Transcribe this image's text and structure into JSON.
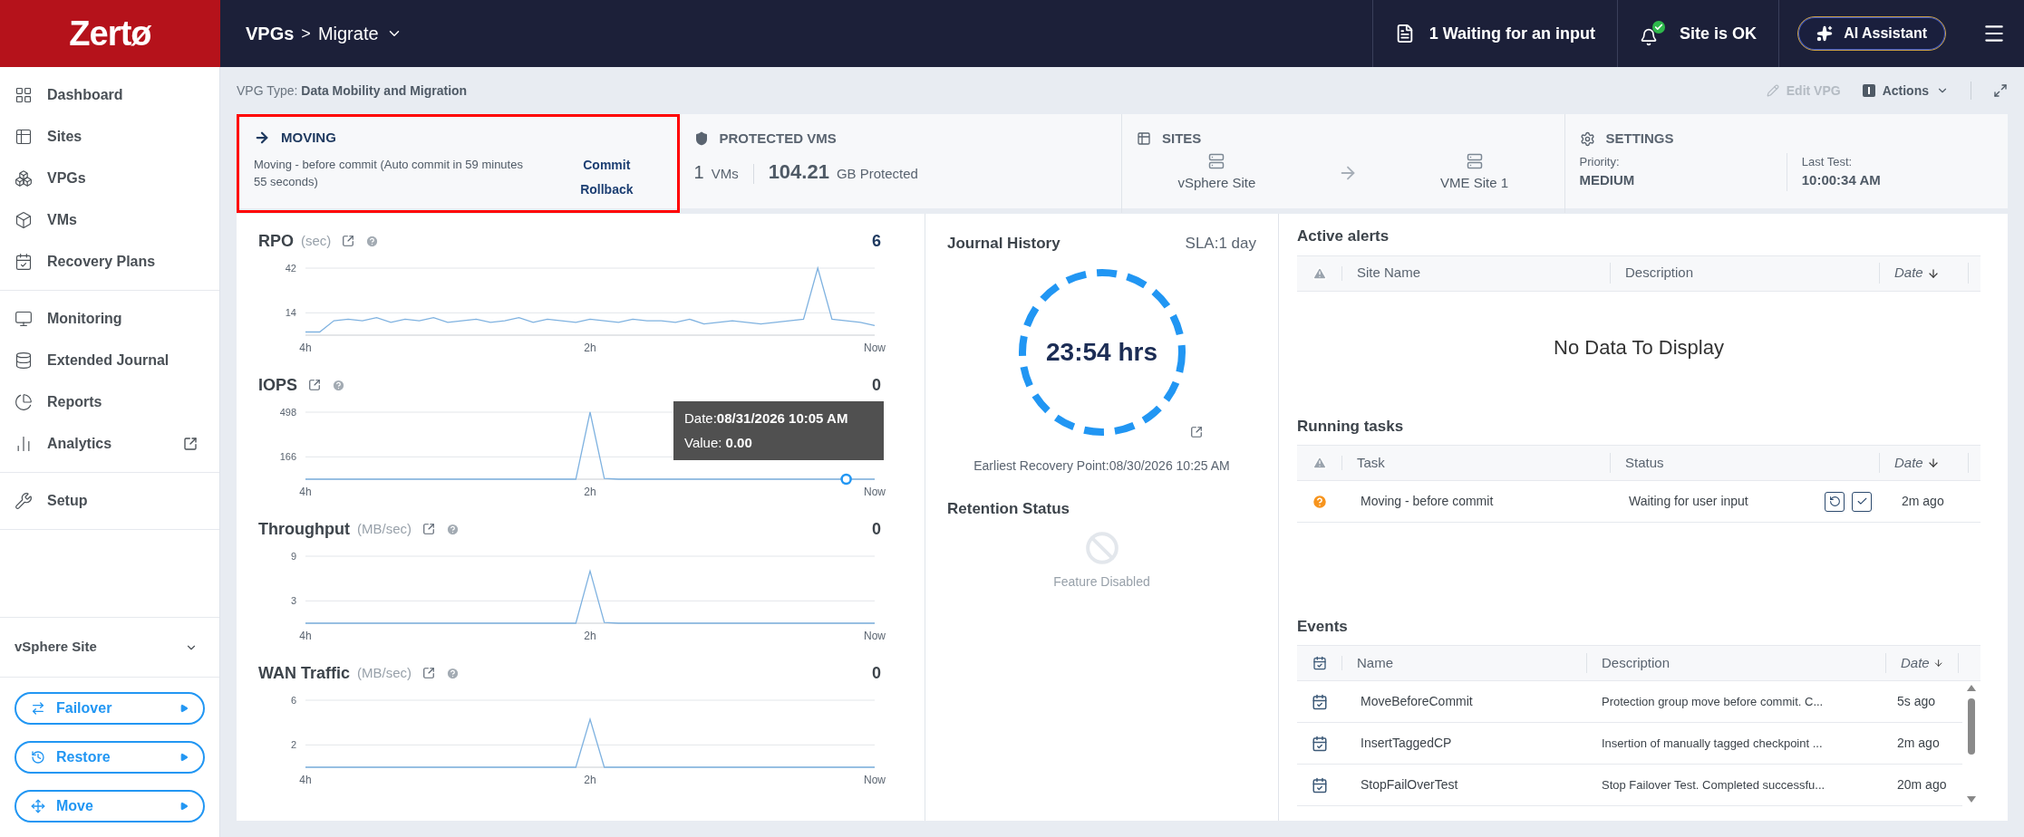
{
  "logo": "Zertø",
  "breadcrumb": {
    "parent": "VPGs",
    "separator": ">",
    "current": "Migrate"
  },
  "header_status": [
    {
      "kind": "tasks",
      "label": "1 Waiting for an input"
    },
    {
      "kind": "site",
      "label": "Site is OK"
    }
  ],
  "ai_button": "AI Assistant",
  "sidebar": {
    "groups": [
      [
        {
          "label": "Dashboard",
          "external": false
        },
        {
          "label": "Sites",
          "external": false
        },
        {
          "label": "VPGs",
          "external": false
        },
        {
          "label": "VMs",
          "external": false
        },
        {
          "label": "Recovery Plans",
          "external": false
        }
      ],
      [
        {
          "label": "Monitoring",
          "external": false
        },
        {
          "label": "Extended Journal",
          "external": false
        },
        {
          "label": "Reports",
          "external": false
        },
        {
          "label": "Analytics",
          "external": true
        }
      ],
      [
        {
          "label": "Setup",
          "external": false
        }
      ]
    ],
    "site_selector": "vSphere Site",
    "actions": [
      "Failover",
      "Restore",
      "Move"
    ]
  },
  "vpg_type": {
    "label": "VPG Type:",
    "value": "Data Mobility and Migration"
  },
  "toolbar": [
    {
      "label": "Edit VPG",
      "disabled": true
    },
    {
      "label": "Actions",
      "disabled": false
    }
  ],
  "status_card": {
    "title": "MOVING",
    "highlighted": true,
    "description": "Moving - before commit (Auto commit in 59 minutes 55 seconds)",
    "links": [
      "Commit",
      "Rollback"
    ]
  },
  "protected_card": {
    "title": "PROTECTED VMS",
    "count": "1",
    "count_unit": "VMs",
    "size": "104.21",
    "size_unit": "GB Protected"
  },
  "sites_card": {
    "title": "SITES",
    "source": "vSphere Site",
    "target": "VME Site 1"
  },
  "settings_card": {
    "title": "SETTINGS",
    "fields": [
      {
        "label": "Priority:",
        "value": "MEDIUM"
      },
      {
        "label": "Last Test:",
        "value": "10:00:34 AM"
      }
    ]
  },
  "charts": [
    {
      "title": "RPO",
      "unit": "(sec)",
      "value": "6",
      "value_highlight": true,
      "chart_data": {
        "type": "line",
        "x": [
          4,
          3.9,
          3.8,
          3.7,
          3.6,
          3.5,
          3.4,
          3.3,
          3.2,
          3.1,
          3,
          2.9,
          2.8,
          2.7,
          2.6,
          2.5,
          2.4,
          2.3,
          2.2,
          2.1,
          2,
          1.9,
          1.8,
          1.7,
          1.6,
          1.5,
          1.4,
          1.3,
          1.2,
          1.1,
          1,
          0.9,
          0.8,
          0.7,
          0.6,
          0.5,
          0.4,
          0.3,
          0.2,
          0.1,
          0
        ],
        "xlim": [
          4,
          0
        ],
        "ylim": [
          0,
          42
        ],
        "yticks": [
          14,
          42
        ],
        "xticks": [
          {
            "value": 4,
            "label": "4h"
          },
          {
            "value": 2,
            "label": "2h"
          },
          {
            "value": 0,
            "label": "Now"
          }
        ],
        "series": [
          {
            "color": "#7fb2e0",
            "values": [
              2,
              2,
              9,
              10,
              9,
              11,
              8,
              10,
              9,
              11,
              8,
              9,
              10,
              8,
              9,
              11,
              8,
              10,
              9,
              8,
              10,
              9,
              8,
              10,
              9,
              9,
              8,
              10,
              7,
              8,
              9,
              8,
              7,
              8,
              9,
              10,
              42,
              10,
              9,
              8,
              6
            ]
          }
        ]
      }
    },
    {
      "title": "IOPS",
      "value": "0",
      "value_highlight": false,
      "tooltip": {
        "date": "Date:**08/31/2026 10:05 AM**",
        "value": "Value: **0.00**"
      },
      "chart_data": {
        "type": "line",
        "x": [
          4,
          3.9,
          3.8,
          3.7,
          3.6,
          3.5,
          3.4,
          3.3,
          3.2,
          3.1,
          3,
          2.9,
          2.8,
          2.7,
          2.6,
          2.5,
          2.4,
          2.3,
          2.2,
          2.1,
          2,
          1.9,
          1.8,
          1.7,
          1.6,
          1.5,
          1.4,
          1.3,
          1.2,
          1.1,
          1,
          0.9,
          0.8,
          0.7,
          0.6,
          0.5,
          0.4,
          0.3,
          0.2,
          0.1,
          0
        ],
        "xlim": [
          4,
          0
        ],
        "ylim": [
          0,
          498
        ],
        "yticks": [
          166,
          498
        ],
        "xticks": [
          {
            "value": 4,
            "label": "4h"
          },
          {
            "value": 2,
            "label": "2h"
          },
          {
            "value": 0,
            "label": "Now"
          }
        ],
        "series": [
          {
            "color": "#7fb2e0",
            "values": [
              0,
              0,
              0,
              0,
              0,
              0,
              0,
              0,
              0,
              0,
              0,
              0,
              0,
              0,
              0,
              0,
              0,
              0,
              0,
              0,
              498,
              6,
              0,
              0,
              0,
              0,
              0,
              0,
              0,
              0,
              0,
              0,
              0,
              0,
              0,
              0,
              0,
              0,
              0,
              0,
              0
            ]
          }
        ]
      }
    },
    {
      "title": "Throughput",
      "unit": "(MB/sec)",
      "value": "0",
      "value_highlight": false,
      "chart_data": {
        "type": "line",
        "x": [
          4,
          3.9,
          3.8,
          3.7,
          3.6,
          3.5,
          3.4,
          3.3,
          3.2,
          3.1,
          3,
          2.9,
          2.8,
          2.7,
          2.6,
          2.5,
          2.4,
          2.3,
          2.2,
          2.1,
          2,
          1.9,
          1.8,
          1.7,
          1.6,
          1.5,
          1.4,
          1.3,
          1.2,
          1.1,
          1,
          0.9,
          0.8,
          0.7,
          0.6,
          0.5,
          0.4,
          0.3,
          0.2,
          0.1,
          0
        ],
        "xlim": [
          4,
          0
        ],
        "ylim": [
          0,
          9
        ],
        "yticks": [
          3,
          9
        ],
        "xticks": [
          {
            "value": 4,
            "label": "4h"
          },
          {
            "value": 2,
            "label": "2h"
          },
          {
            "value": 0,
            "label": "Now"
          }
        ],
        "series": [
          {
            "color": "#7fb2e0",
            "values": [
              0,
              0,
              0,
              0,
              0,
              0,
              0,
              0,
              0,
              0,
              0,
              0,
              0,
              0,
              0,
              0,
              0,
              0,
              0,
              0,
              7,
              0.1,
              0,
              0,
              0,
              0,
              0,
              0,
              0,
              0,
              0,
              0,
              0,
              0,
              0,
              0,
              0,
              0,
              0,
              0,
              0
            ]
          }
        ]
      }
    },
    {
      "title": "WAN Traffic",
      "unit": "(MB/sec)",
      "value": "0",
      "value_highlight": false,
      "chart_data": {
        "type": "line",
        "x": [
          4,
          3.9,
          3.8,
          3.7,
          3.6,
          3.5,
          3.4,
          3.3,
          3.2,
          3.1,
          3,
          2.9,
          2.8,
          2.7,
          2.6,
          2.5,
          2.4,
          2.3,
          2.2,
          2.1,
          2,
          1.9,
          1.8,
          1.7,
          1.6,
          1.5,
          1.4,
          1.3,
          1.2,
          1.1,
          1,
          0.9,
          0.8,
          0.7,
          0.6,
          0.5,
          0.4,
          0.3,
          0.2,
          0.1,
          0
        ],
        "xlim": [
          4,
          0
        ],
        "ylim": [
          0,
          6
        ],
        "yticks": [
          2,
          6
        ],
        "xticks": [
          {
            "value": 4,
            "label": "4h"
          },
          {
            "value": 2,
            "label": "2h"
          },
          {
            "value": 0,
            "label": "Now"
          }
        ],
        "series": [
          {
            "color": "#7fb2e0",
            "values": [
              0,
              0,
              0,
              0,
              0,
              0,
              0,
              0,
              0,
              0,
              0,
              0,
              0,
              0,
              0,
              0,
              0,
              0,
              0,
              0,
              4.3,
              0,
              0,
              0,
              0,
              0,
              0,
              0,
              0,
              0,
              0,
              0,
              0,
              0,
              0,
              0,
              0,
              0,
              0,
              0,
              0
            ]
          }
        ]
      }
    }
  ],
  "journal": {
    "title": "Journal History",
    "sla": "SLA:1 day",
    "hours": "23:54 hrs",
    "earliest": "Earliest Recovery Point:08/30/2026 10:25 AM",
    "retention_title": "Retention Status",
    "retention_status": "Feature Disabled"
  },
  "active_alerts": {
    "title": "Active alerts",
    "columns": [
      "Site Name",
      "Description",
      "Date"
    ],
    "empty": "No Data To Display"
  },
  "running_tasks": {
    "title": "Running tasks",
    "columns": [
      "Task",
      "Status",
      "Date"
    ],
    "rows": [
      {
        "task": "Moving - before commit",
        "status": "Waiting for user input",
        "date": "2m ago"
      }
    ]
  },
  "events": {
    "title": "Events",
    "columns": [
      "Name",
      "Description",
      "Date"
    ],
    "rows": [
      {
        "name": "MoveBeforeCommit",
        "description": "Protection group move before commit. C...",
        "date": "5s ago"
      },
      {
        "name": "InsertTaggedCP",
        "description": "Insertion of manually tagged checkpoint ...",
        "date": "2m ago"
      },
      {
        "name": "StopFailOverTest",
        "description": "Stop Failover Test. Completed successfu...",
        "date": "20m ago"
      }
    ]
  }
}
